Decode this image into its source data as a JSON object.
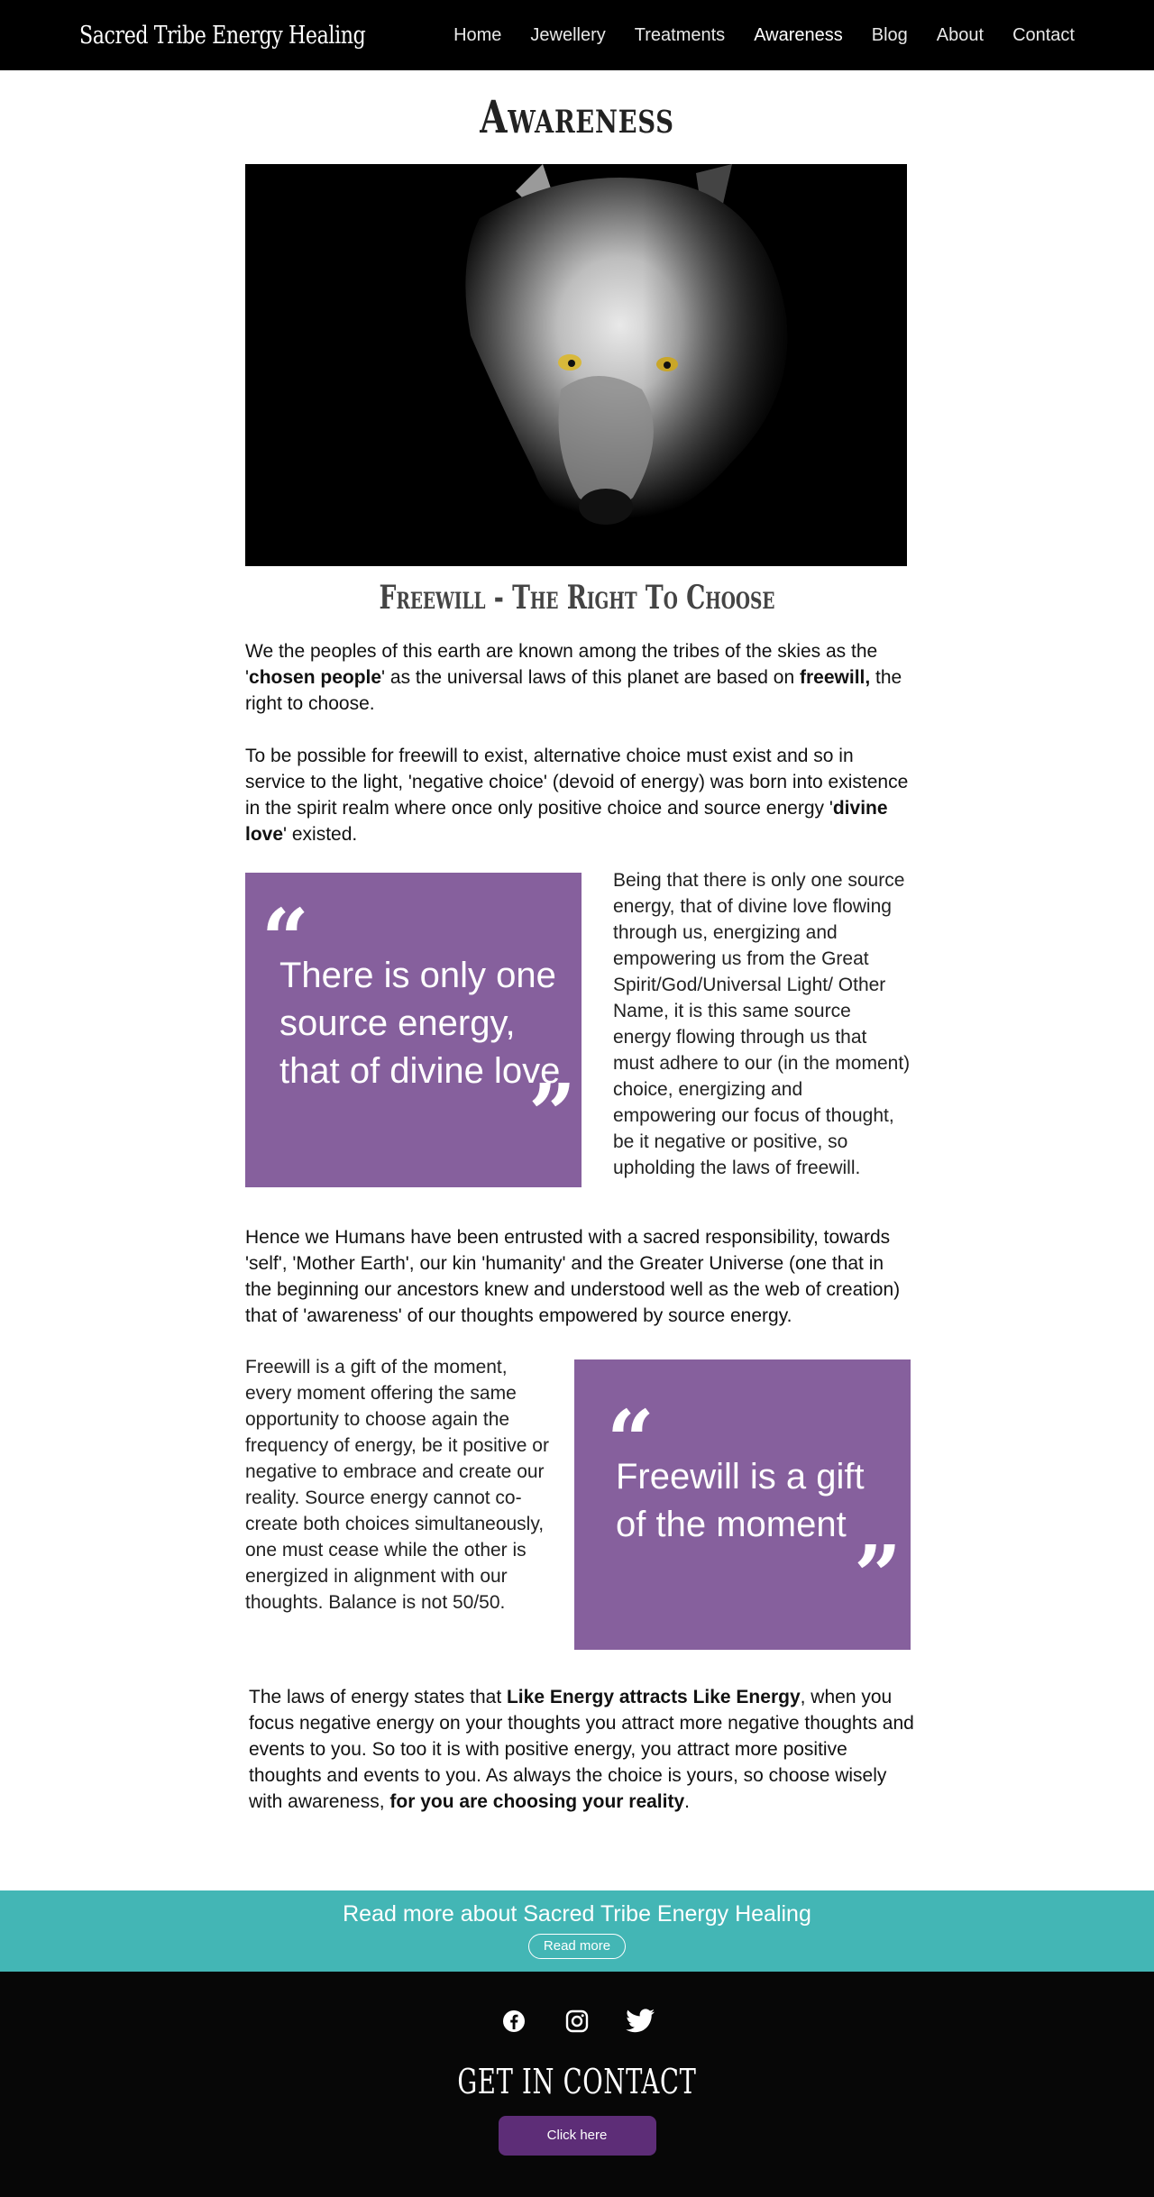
{
  "header": {
    "brand": "Sacred Tribe Energy Healing",
    "nav": [
      {
        "label": "Home"
      },
      {
        "label": "Jewellery"
      },
      {
        "label": "Treatments"
      },
      {
        "label": "Awareness",
        "active": true
      },
      {
        "label": "Blog"
      },
      {
        "label": "About"
      },
      {
        "label": "Contact"
      }
    ]
  },
  "main": {
    "page_title": "Awareness",
    "hero_image": "white-wolf-portrait",
    "section_heading": "Freewill -  The Right To Choose",
    "p1": {
      "t1": "We the peoples of this earth are known among the tribes of the skies as the '",
      "b1": "chosen people",
      "t2": "' as the universal laws of this planet are based on ",
      "b2": "freewill,",
      "t3": " the right to choose."
    },
    "p2": {
      "t1": "To be possible for freewill to exist, alternative choice must exist and so in service to the light, 'negative choice' (devoid of energy) was born into existence in the spirit realm where once only positive choice and source energy '",
      "b1": "divine love",
      "t2": "' existed."
    },
    "quote1": {
      "open": "“",
      "text": "There is only one source energy, that of divine love",
      "close": "”"
    },
    "side1": "Being that there is only one source energy, that of divine love flowing through us, energizing and empowering us from the Great Spirit/God/Universal Light/ Other Name, it is this same source energy flowing through us that must adhere to our (in the moment) choice, energizing and empowering our focus of thought, be it negative or positive, so upholding the laws of freewill.",
    "p3": "Hence we Humans have been entrusted with a sacred responsibility, towards 'self', 'Mother Earth', our kin 'humanity' and the Greater Universe (one that in the beginning our ancestors knew and understood well as the web of creation) that of 'awareness' of our thoughts empowered by source energy.",
    "side2": "Freewill is a gift of the moment, every moment offering the same opportunity to choose again the frequency of energy, be it positive or negative to embrace and create our reality. Source energy cannot co-create both choices simultaneously, one must cease while the other is energized in alignment with our thoughts. Balance is not 50/50.",
    "quote2": {
      "open": "“",
      "text": "Freewill is a gift of the moment",
      "close": "”"
    },
    "p4": {
      "t1": "The laws of energy states that ",
      "b1": "Like Energy attracts Like Energy",
      "t2": ", when you focus negative energy on your thoughts you attract more negative thoughts and events to you. So too it is with positive energy, you attract more positive thoughts and events to you. As always the choice is yours, so choose wisely with awareness, ",
      "b2": "for you are choosing your reality",
      "t3": "."
    }
  },
  "readmore": {
    "title": "Read more about Sacred Tribe Energy Healing",
    "button": "Read more"
  },
  "footer": {
    "social": [
      "facebook-icon",
      "instagram-icon",
      "twitter-icon"
    ],
    "heading": "GET IN CONTACT",
    "button": "Click here"
  },
  "colors": {
    "header_bg": "#000000",
    "quote_bg": "#86609d",
    "band_bg": "#43b6b5",
    "footer_bg": "#070707",
    "contact_button": "#5d2d77"
  }
}
